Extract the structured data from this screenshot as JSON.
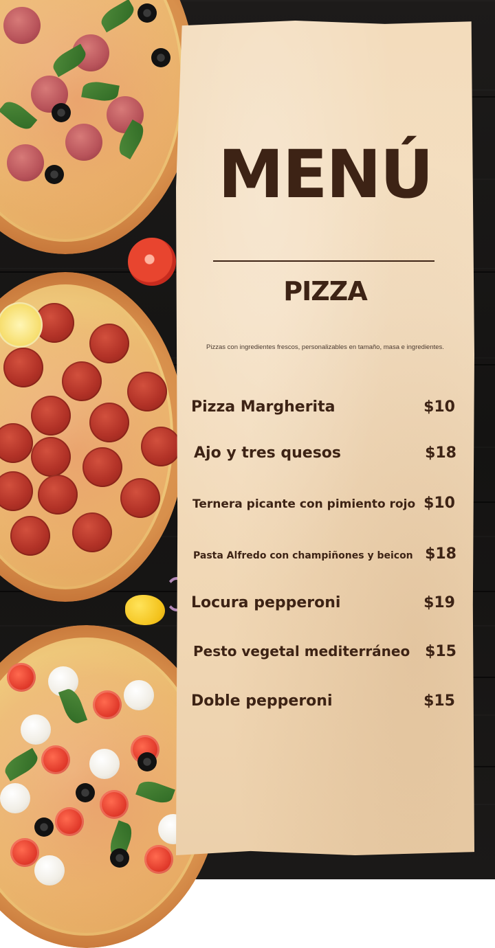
{
  "menu": {
    "title": "MENÚ",
    "category": "PIZZA",
    "description": "Pizzas con ingredientes frescos, personalizables en tamaño, masa e ingredientes.",
    "items": [
      {
        "name": "Pizza Margherita",
        "price": "$10"
      },
      {
        "name": "Ajo y tres quesos",
        "price": "$18"
      },
      {
        "name": "Ternera picante con pimiento rojo",
        "price": "$10"
      },
      {
        "name": "Pasta Alfredo con champiñones y beicon",
        "price": "$18"
      },
      {
        "name": "Locura pepperoni",
        "price": "$19"
      },
      {
        "name": "Pesto vegetal mediterráneo",
        "price": "$15"
      },
      {
        "name": "Doble pepperoni",
        "price": "$15"
      }
    ]
  },
  "colors": {
    "text": "#3d2315",
    "paper": "#f3dcbc",
    "background": "#181716"
  }
}
